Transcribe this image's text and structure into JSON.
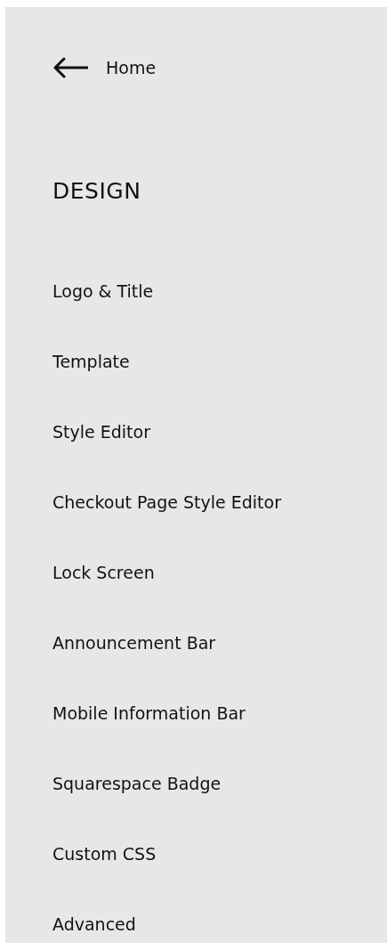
{
  "back_link": {
    "label": "Home"
  },
  "section": {
    "title": "DESIGN"
  },
  "menu_items": [
    {
      "label": "Logo & Title"
    },
    {
      "label": "Template"
    },
    {
      "label": "Style Editor"
    },
    {
      "label": "Checkout Page Style Editor"
    },
    {
      "label": "Lock Screen"
    },
    {
      "label": "Announcement Bar"
    },
    {
      "label": "Mobile Information Bar"
    },
    {
      "label": "Squarespace Badge"
    },
    {
      "label": "Custom CSS"
    },
    {
      "label": "Advanced"
    }
  ]
}
